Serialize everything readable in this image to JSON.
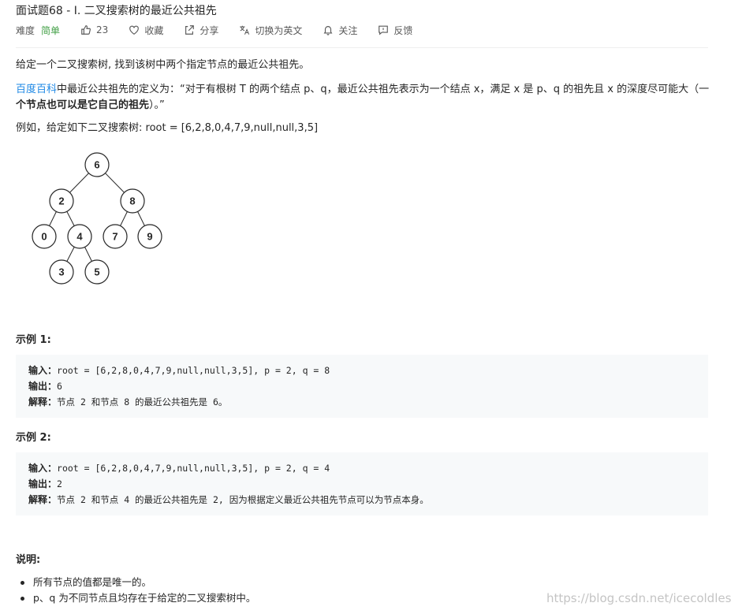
{
  "problem": {
    "title": "面试题68 - I. 二叉搜索树的最近公共祖先"
  },
  "meta": {
    "difficulty_label": "难度",
    "difficulty_value": "简单",
    "likes": "23",
    "favorite": "收藏",
    "share": "分享",
    "switch_lang": "切换为英文",
    "follow": "关注",
    "feedback": "反馈",
    "icons": [
      "thumbs-up-icon",
      "heart-icon",
      "share-icon",
      "translate-icon",
      "bell-icon",
      "feedback-icon"
    ]
  },
  "description": {
    "intro": "给定一个二叉搜索树, 找到该树中两个指定节点的最近公共祖先。",
    "def_link": "百度百科",
    "def_text1": "中最近公共祖先的定义为：“对于有根树 T 的两个结点 p、q，最近公共祖先表示为一个结点 x，满足 x 是 p、q 的祖先且 x 的深度尽可能大（一",
    "def_bold": "个节点也可以是它自己的祖先",
    "def_text2": "）。”",
    "example_intro": "例如，给定如下二叉搜索树:  root = [6,2,8,0,4,7,9,null,null,3,5]"
  },
  "tree_nodes": [
    "6",
    "2",
    "8",
    "0",
    "4",
    "7",
    "9",
    "3",
    "5"
  ],
  "examples": [
    {
      "heading": "示例 1:",
      "input_label": "输入：",
      "input": "root = [6,2,8,0,4,7,9,null,null,3,5], p = 2, q = 8",
      "output_label": "输出：",
      "output": "6",
      "explain_label": "解释：",
      "explain": "节点 2 和节点 8 的最近公共祖先是 6。"
    },
    {
      "heading": "示例 2:",
      "input_label": "输入：",
      "input": "root = [6,2,8,0,4,7,9,null,null,3,5], p = 2, q = 4",
      "output_label": "输出：",
      "output": "2",
      "explain_label": "解释：",
      "explain": "节点 2 和节点 4 的最近公共祖先是 2, 因为根据定义最近公共祖先节点可以为节点本身。"
    }
  ],
  "notes": {
    "heading": "说明:",
    "items": [
      "所有节点的值都是唯一的。",
      "p、q 为不同节点且均存在于给定的二叉搜索树中。"
    ]
  },
  "watermark": "https://blog.csdn.net/icecoldless",
  "colors": {
    "difficulty_easy": "#43a047",
    "link": "#1e88e5",
    "code_bg": "#f7f9fa",
    "text": "#262626",
    "muted": "#595959"
  }
}
